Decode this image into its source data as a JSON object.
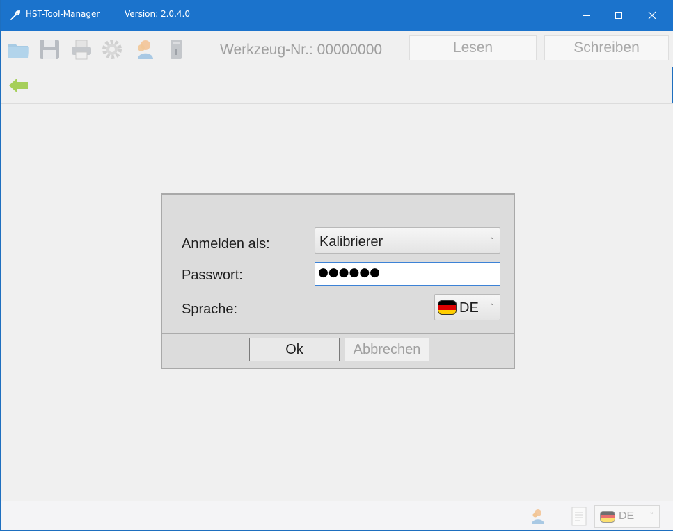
{
  "titlebar": {
    "title": "HST-Tool-Manager",
    "version": "Version: 2.0.4.0",
    "icon": "wrench-icon"
  },
  "toolbar": {
    "icons": [
      "folder-open-icon",
      "save-icon",
      "print-icon",
      "settings-gear-icon",
      "user-icon",
      "usb-device-icon"
    ],
    "tool_number": "Werkzeug-Nr.: 00000000",
    "read_label": "Lesen",
    "write_label": "Schreiben",
    "back_icon": "back-arrow-icon"
  },
  "login_dialog": {
    "login_as_label": "Anmelden als:",
    "login_as_value": "Kalibrierer",
    "password_label": "Passwort:",
    "password_value": "●●●●●●",
    "language_label": "Sprache:",
    "language_value": "DE",
    "ok_label": "Ok",
    "cancel_label": "Abbrechen"
  },
  "statusbar": {
    "language_value": "DE",
    "icons": [
      "user-icon",
      "document-icon",
      "german-flag-icon"
    ]
  },
  "colors": {
    "titlebar": "#1b73cc",
    "accent_input_border": "#3c82d6",
    "back_arrow": "#a6cf5a"
  }
}
